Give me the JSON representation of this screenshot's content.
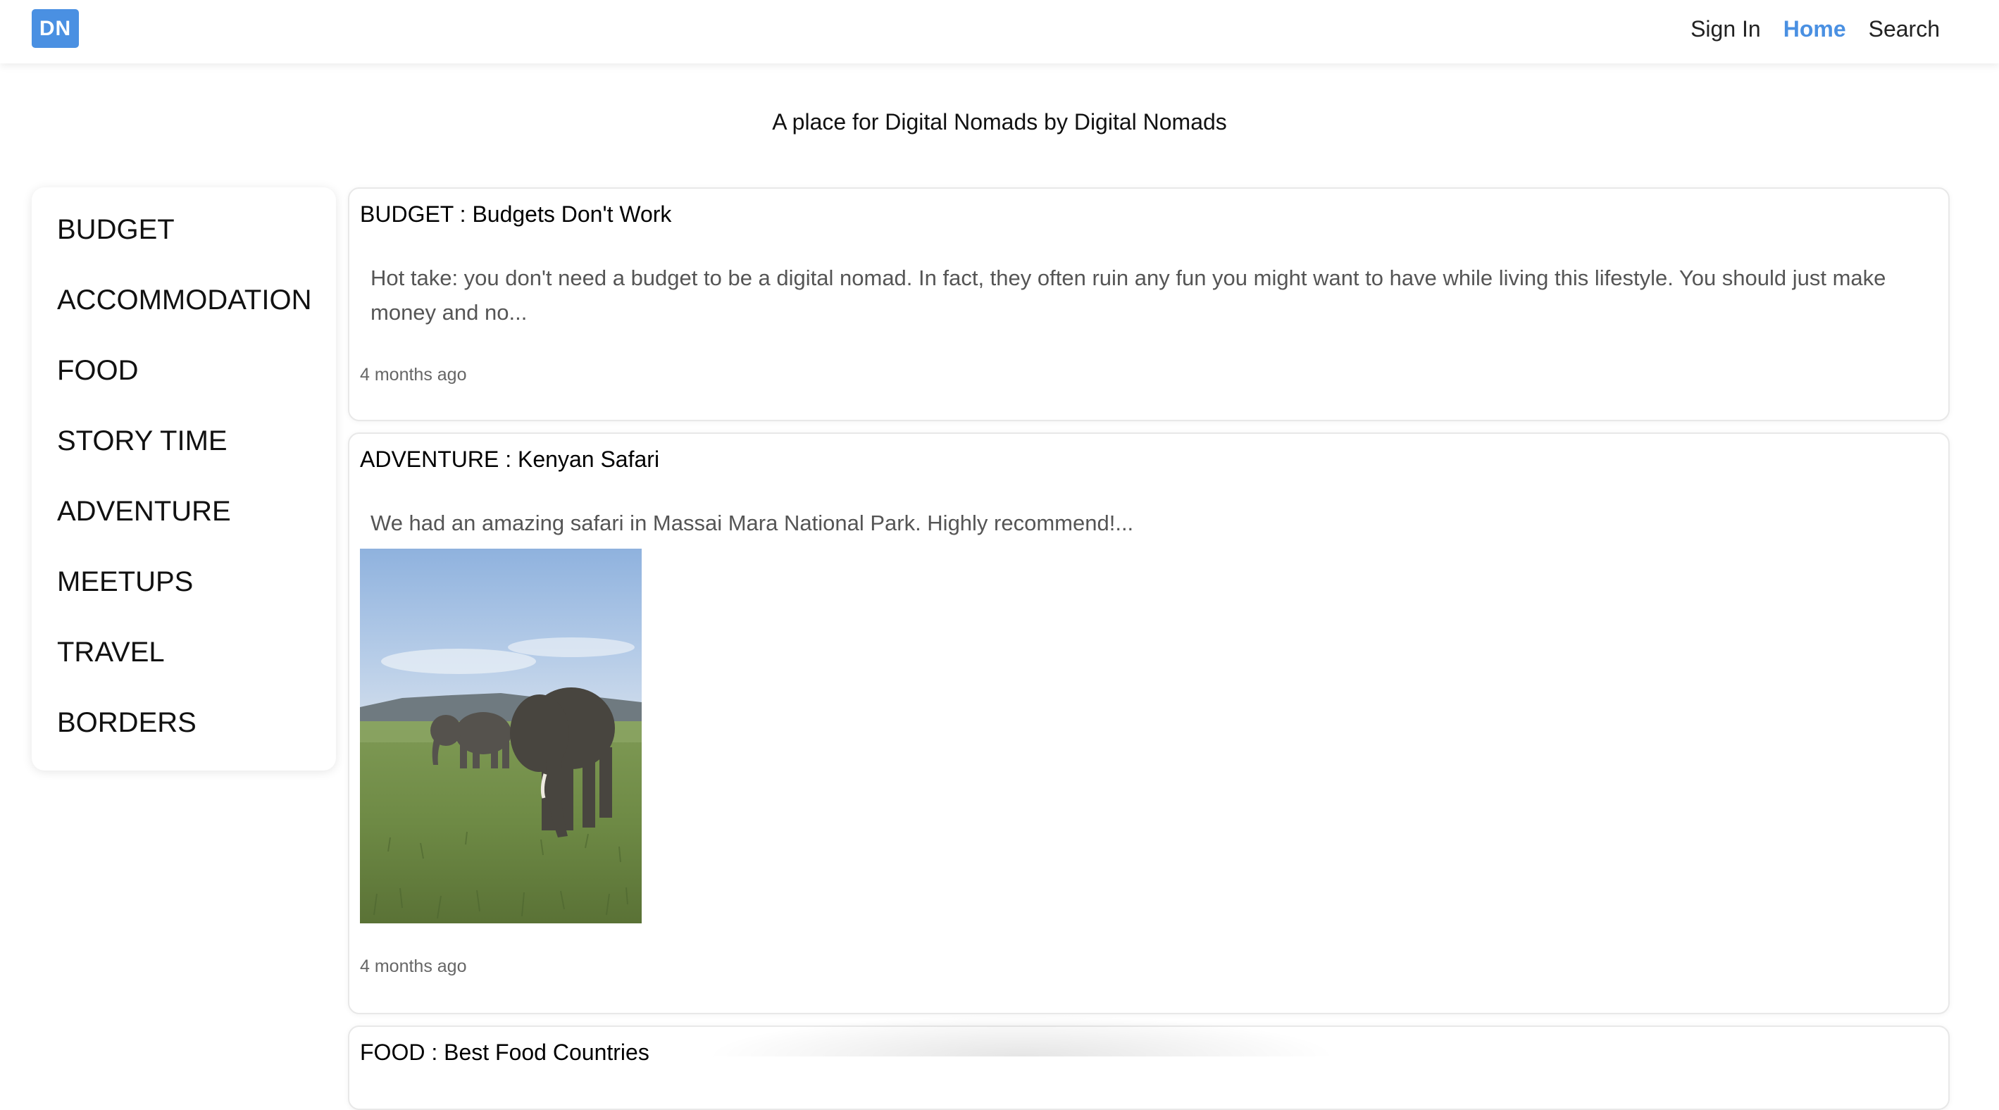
{
  "navbar": {
    "logo_text": "DN",
    "links": [
      "Sign In",
      "Home",
      "Search"
    ],
    "active_link": "Home",
    "accent_color": "#4a90e2"
  },
  "tagline": "A place for Digital Nomads by Digital Nomads",
  "sidebar": {
    "items": [
      "BUDGET",
      "ACCOMMODATION",
      "FOOD",
      "STORY TIME",
      "ADVENTURE",
      "MEETUPS",
      "TRAVEL",
      "BORDERS"
    ]
  },
  "posts": [
    {
      "title": "BUDGET : Budgets Don't Work",
      "excerpt": "Hot take: you don't need a budget to be a digital nomad. In fact, they often ruin any fun you might want to have while living this lifestyle. You should just make money and no...",
      "time": "4 months ago"
    },
    {
      "title": "ADVENTURE : Kenyan Safari",
      "excerpt": "We had an amazing safari in Massai Mara National Park. Highly recommend!...",
      "image": "elephants-savanna-photo",
      "time": "4 months ago"
    },
    {
      "title": "FOOD : Best Food Countries"
    }
  ]
}
